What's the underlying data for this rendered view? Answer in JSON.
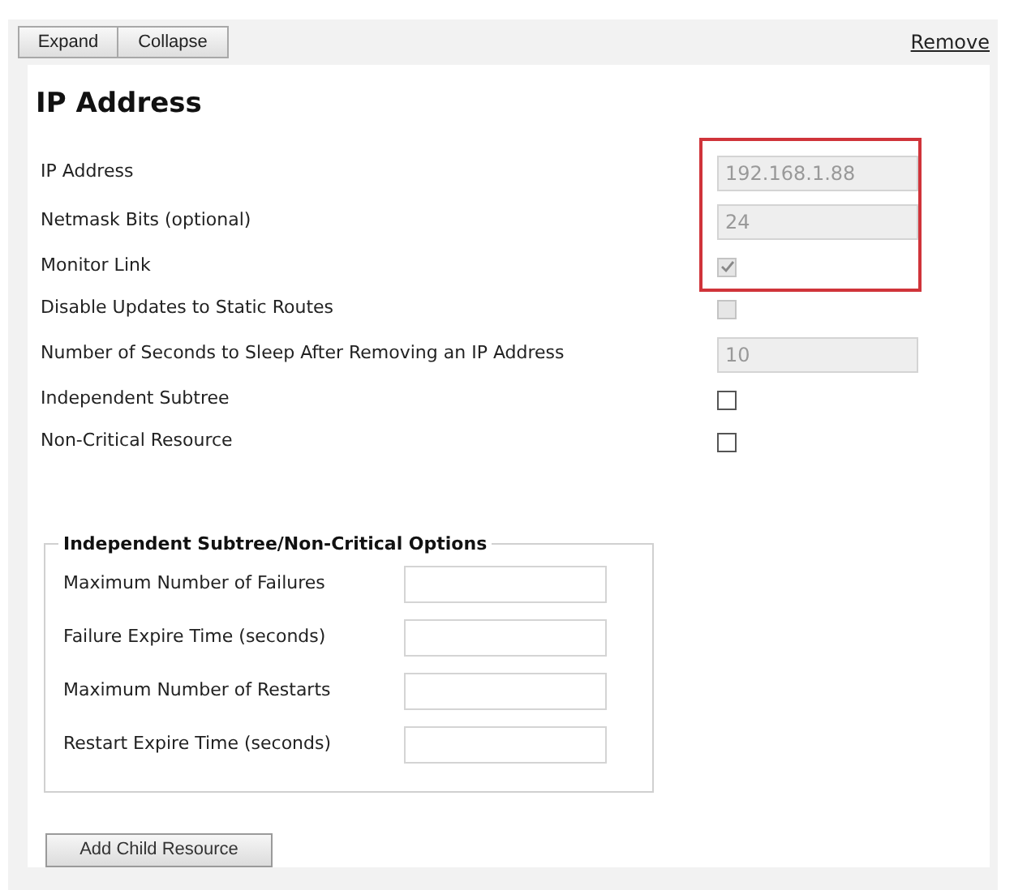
{
  "toolbar": {
    "buttons": [
      "Expand",
      "Collapse"
    ],
    "remove_link": "Remove"
  },
  "title": "IP Address",
  "highlighted_fields": [
    {
      "label": "IP Address",
      "kind": "text",
      "value": "192.168.1.88",
      "disabled": true
    },
    {
      "label": "Netmask Bits (optional)",
      "kind": "text",
      "value": "24",
      "disabled": true
    },
    {
      "label": "Monitor Link",
      "kind": "checkbox",
      "checked": true,
      "disabled": true
    }
  ],
  "fields": [
    {
      "label": "Disable Updates to Static Routes",
      "kind": "checkbox",
      "checked": false,
      "disabled": true
    },
    {
      "label": "Number of Seconds to Sleep After Removing an IP Address",
      "kind": "text",
      "value": "10",
      "disabled": true
    },
    {
      "label": "Independent Subtree",
      "kind": "checkbox",
      "checked": false,
      "disabled": false
    },
    {
      "label": "Non-Critical Resource",
      "kind": "checkbox",
      "checked": false,
      "disabled": false
    }
  ],
  "options_group": {
    "legend": "Independent Subtree/Non-Critical Options",
    "fields": [
      {
        "label": "Maximum Number of Failures"
      },
      {
        "label": "Failure Expire Time (seconds)"
      },
      {
        "label": "Maximum Number of Restarts"
      },
      {
        "label": "Restart Expire Time (seconds)"
      }
    ]
  },
  "add_button": "Add Child Resource"
}
